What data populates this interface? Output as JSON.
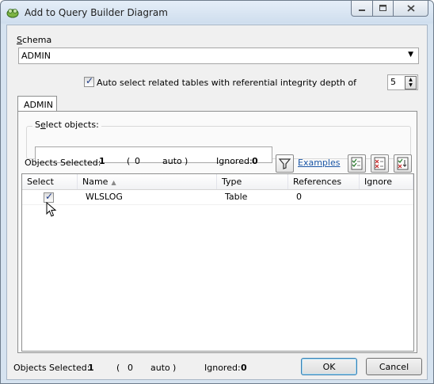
{
  "window": {
    "title": "Add to Query Builder Diagram",
    "icon": "query-builder-icon"
  },
  "schema": {
    "label_mnemonic": "S",
    "label_rest": "chema",
    "value": "ADMIN"
  },
  "auto_select": {
    "checked": true,
    "label": "Auto select related tables with referential integrity depth of",
    "depth": "5"
  },
  "tab": {
    "label": "ADMIN"
  },
  "select_objects": {
    "label_pre": "S",
    "label_mnemonic": "e",
    "label_rest": "lect objects:",
    "search_value": "",
    "examples_link": "Examples"
  },
  "summary": {
    "objects_selected_label": "Objects Selected:",
    "objects_selected_count": "1",
    "open_paren": "(",
    "auto_count": "0",
    "auto_label": "auto",
    "close_paren": ")",
    "ignored_label": "Ignored:",
    "ignored_count": "0"
  },
  "table": {
    "columns": [
      "Select",
      "Name",
      "Type",
      "References",
      "Ignore"
    ],
    "sort_column": "Name",
    "rows": [
      {
        "select": true,
        "name": "WLSLOG",
        "type": "Table",
        "references": "0",
        "ignore": ""
      }
    ]
  },
  "footer": {
    "objects_selected_label": "Objects Selected:",
    "objects_selected_count": "1",
    "open_paren": "(",
    "auto_count": "0",
    "auto_label": "auto",
    "close_paren": ")",
    "ignored_label": "Ignored:",
    "ignored_count": "0",
    "ok_label": "OK",
    "cancel_label": "Cancel"
  }
}
